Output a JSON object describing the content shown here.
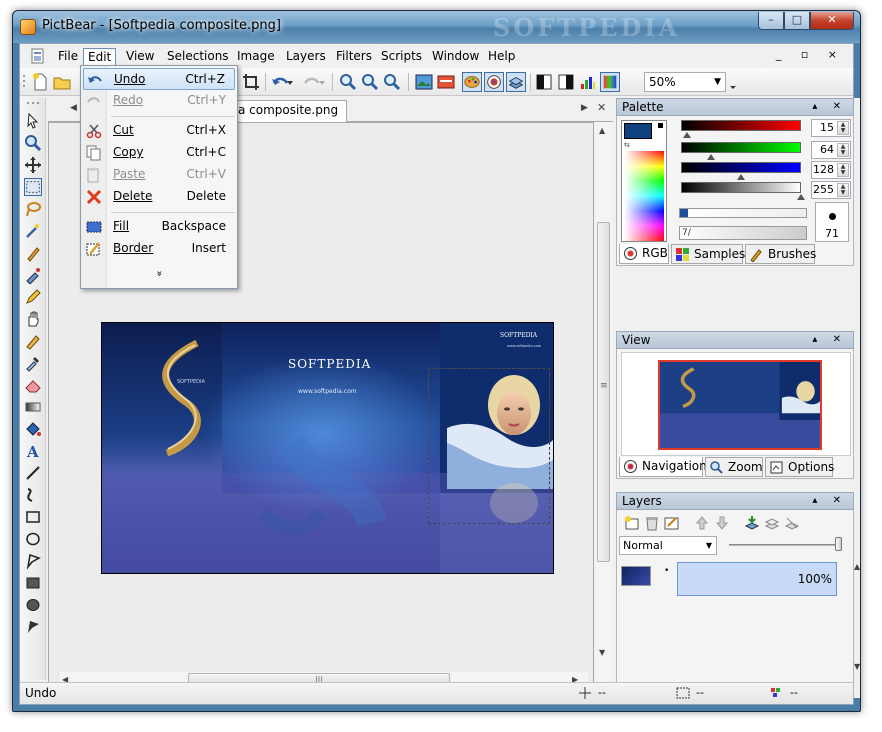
{
  "window": {
    "title": "PictBear - [Softpedia composite.png]",
    "watermark": "SOFTPEDIA",
    "caption_buttons": [
      "–",
      "□",
      "✕"
    ]
  },
  "menubar": {
    "items": [
      "File",
      "Edit",
      "View",
      "Selections",
      "Image",
      "Layers",
      "Filters",
      "Scripts",
      "Window",
      "Help"
    ],
    "active": "Edit",
    "mdi_buttons": "_ ▫ ×"
  },
  "toolbar": {
    "zoom_value": "50%"
  },
  "document": {
    "tab_label": "a composite.png",
    "image_texts": {
      "brand_center": "SOFTPEDIA",
      "url_center": "www.softpedia.com",
      "brand_left": "SOFTPEDIA",
      "brand_right": "SOFTPEDIA",
      "url_right": "www.softpedia.com"
    },
    "hscroll_grip": "|||",
    "vscroll_grip": "≡"
  },
  "edit_menu": {
    "items": [
      {
        "label": "Undo",
        "shortcut": "Ctrl+Z",
        "enabled": true,
        "highlighted": true,
        "icon": "undo-icon"
      },
      {
        "label": "Redo",
        "shortcut": "Ctrl+Y",
        "enabled": false,
        "icon": "redo-icon"
      },
      {
        "label": "Cut",
        "shortcut": "Ctrl+X",
        "enabled": true,
        "icon": "scissors-icon"
      },
      {
        "label": "Copy",
        "shortcut": "Ctrl+C",
        "enabled": true,
        "icon": "copy-icon"
      },
      {
        "label": "Paste",
        "shortcut": "Ctrl+V",
        "enabled": false,
        "icon": "paste-icon"
      },
      {
        "label": "Delete",
        "shortcut": "Delete",
        "enabled": true,
        "icon": "delete-x-icon"
      },
      {
        "label": "Fill",
        "shortcut": "Backspace",
        "enabled": true,
        "icon": "fill-icon"
      },
      {
        "label": "Border",
        "shortcut": "Insert",
        "enabled": true,
        "icon": "border-icon"
      }
    ],
    "more": "»"
  },
  "palette": {
    "title": "Palette",
    "red": "15",
    "green": "64",
    "blue": "128",
    "alpha": "255",
    "brush_size": "71",
    "opacity_label": "7/",
    "foreground_color": "#0F4080",
    "tabs": [
      "RGB",
      "Samples",
      "Brushes"
    ],
    "active_tab": "RGB"
  },
  "view": {
    "title": "View",
    "tabs": [
      "Navigation",
      "Zoom",
      "Options"
    ],
    "active_tab": "Navigation"
  },
  "layers": {
    "title": "Layers",
    "blend_mode": "Normal",
    "opacity": "100%",
    "layer_marker": "•"
  },
  "statusbar": {
    "text": "Undo",
    "coord_position": "--",
    "coord_size": "--",
    "color_value": "--"
  },
  "panel_controls": "▴ ✕"
}
